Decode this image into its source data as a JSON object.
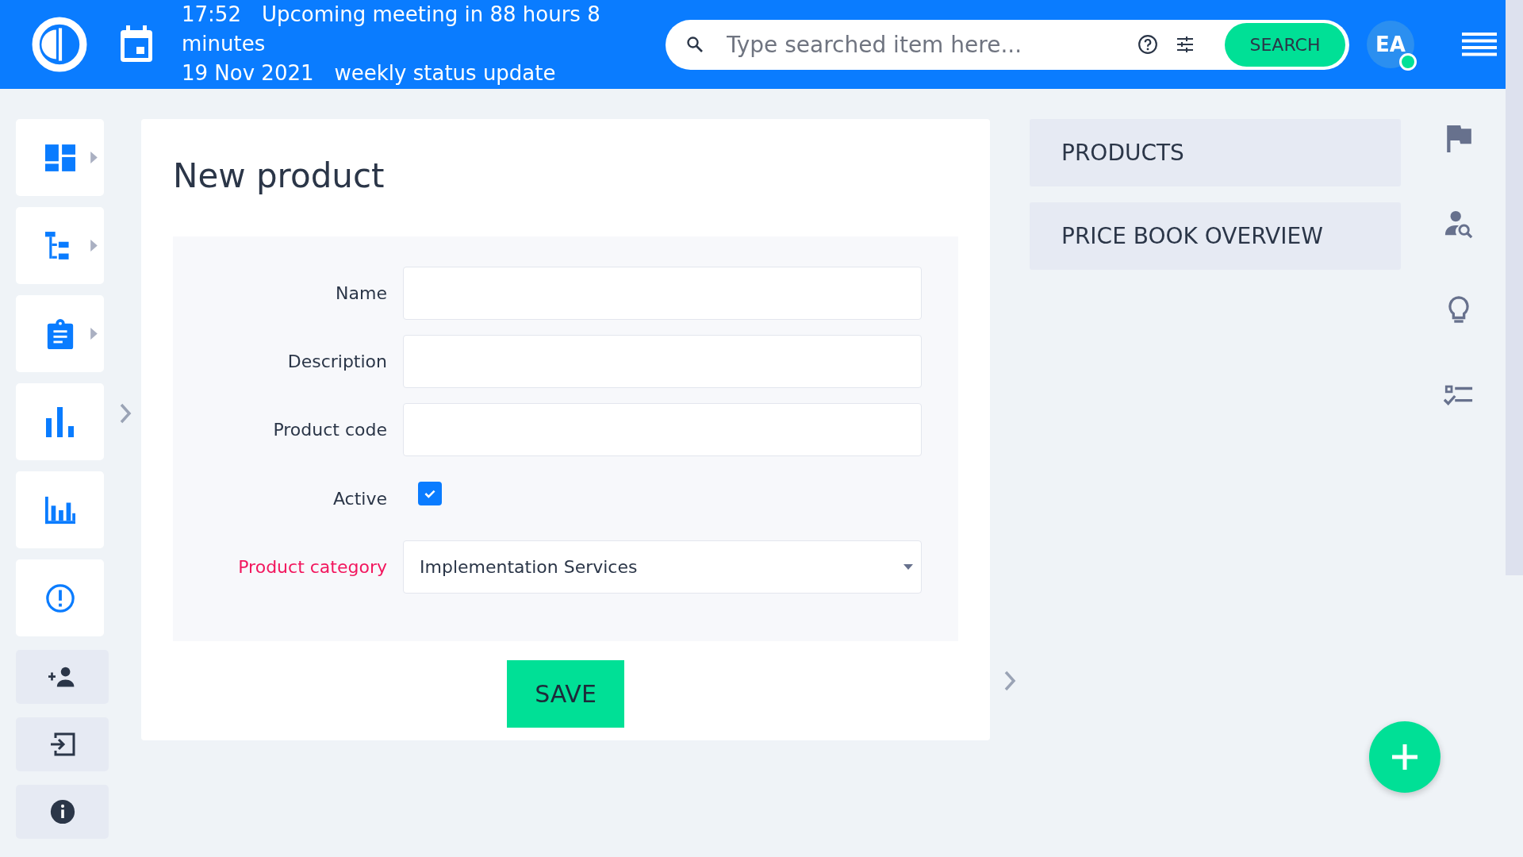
{
  "header": {
    "time": "17:52",
    "message": "Upcoming meeting in 88 hours 8 minutes",
    "date": "19 Nov 2021",
    "event": "weekly status update",
    "search": {
      "placeholder": "Type searched item here...",
      "button": "SEARCH"
    },
    "avatar": {
      "initials": "EA",
      "online": true
    }
  },
  "sidebar": {
    "items": [
      {
        "kind": "main",
        "has_submenu": true
      },
      {
        "kind": "main",
        "has_submenu": true
      },
      {
        "kind": "main",
        "has_submenu": true
      },
      {
        "kind": "main",
        "has_submenu": false
      },
      {
        "kind": "main",
        "has_submenu": false
      },
      {
        "kind": "main",
        "has_submenu": false
      },
      {
        "kind": "utility",
        "has_submenu": false
      },
      {
        "kind": "utility",
        "has_submenu": false
      },
      {
        "kind": "utility",
        "has_submenu": false
      }
    ]
  },
  "form": {
    "title": "New product",
    "fields": [
      {
        "label": "Name",
        "kind": "text",
        "required": false
      },
      {
        "label": "Description",
        "kind": "text",
        "required": false
      },
      {
        "label": "Product code",
        "kind": "text",
        "required": false
      },
      {
        "label": "Active",
        "kind": "checkbox",
        "required": false,
        "checked": true
      },
      {
        "label": "Product category",
        "kind": "select",
        "required": true,
        "value": "Implementation Services"
      }
    ],
    "submit": "SAVE"
  },
  "side_panel": {
    "items": [
      {
        "label": "PRODUCTS"
      },
      {
        "label": "PRICE BOOK OVERVIEW"
      }
    ]
  }
}
